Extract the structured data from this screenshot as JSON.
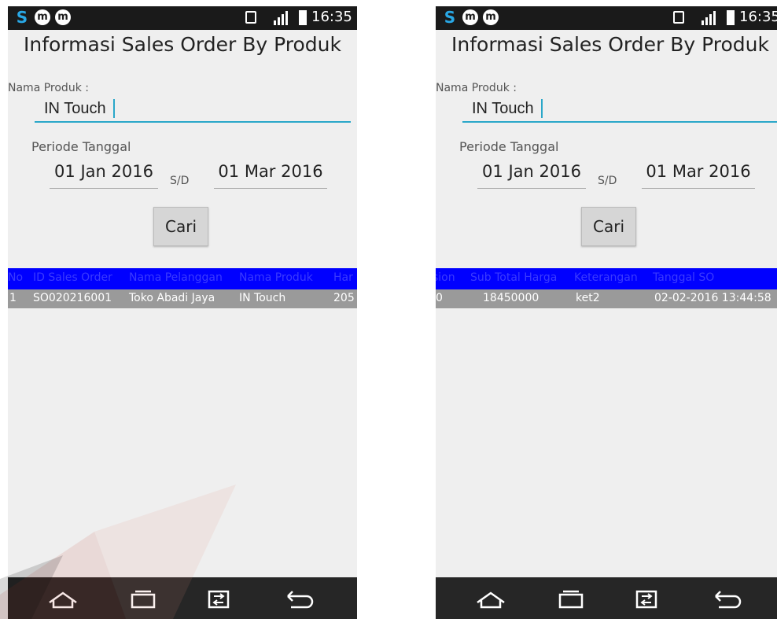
{
  "screens": [
    {
      "status": {
        "time": "16:35"
      },
      "title": "Informasi Sales Order By Produk",
      "form": {
        "produk_label": "Nama Produk :",
        "produk_value": "IN Touch",
        "periode_label": "Periode Tanggal",
        "date_from": "01 Jan 2016",
        "separator": "S/D",
        "date_to": "01 Mar 2016",
        "search_button": "Cari"
      },
      "table": {
        "headers": [
          "No",
          "ID Sales Order",
          "Nama Pelanggan",
          "Nama Produk",
          "Har"
        ],
        "row": [
          "1",
          "SO020216001",
          "Toko Abadi Jaya",
          "IN Touch",
          "205"
        ]
      }
    },
    {
      "status": {
        "time": "16:35"
      },
      "title": "Informasi Sales Order By Produk",
      "form": {
        "produk_label": "Nama Produk :",
        "produk_value": "IN Touch",
        "periode_label": "Periode Tanggal",
        "date_from": "01 Jan 2016",
        "separator": "S/D",
        "date_to": "01 Mar 2016",
        "search_button": "Cari"
      },
      "table": {
        "headers": [
          "sion",
          "Sub Total Harga",
          "Keterangan",
          "Tanggal SO"
        ],
        "row": [
          "0",
          "18450000",
          "ket2",
          "02-02-2016 13:44:58"
        ]
      }
    }
  ],
  "nav_icons": [
    "home-icon",
    "recent-apps-icon",
    "dual-window-icon",
    "back-icon"
  ],
  "colors": {
    "accent": "#2aa7c9",
    "table_header": "#0000ff",
    "table_row": "#9a9a9a",
    "statusbar": "#1a1a1a"
  }
}
